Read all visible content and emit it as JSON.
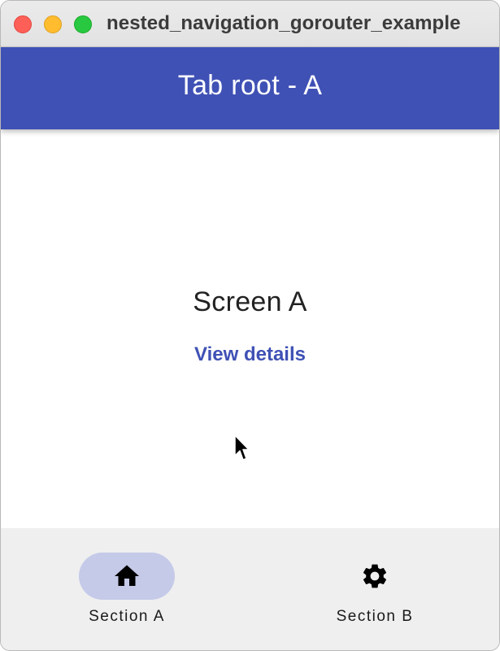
{
  "window": {
    "title": "nested_navigation_gorouter_example",
    "buttons": [
      "close",
      "minimize",
      "maximize"
    ]
  },
  "appbar": {
    "title": "Tab root - A",
    "color": "#3f51b5"
  },
  "main": {
    "screen_title": "Screen A",
    "details_link": "View details"
  },
  "navbar": {
    "items": [
      {
        "label": "Section A",
        "icon": "home-icon",
        "selected": true
      },
      {
        "label": "Section B",
        "icon": "settings-icon",
        "selected": false
      }
    ],
    "indicator_color": "#c5cae9"
  }
}
